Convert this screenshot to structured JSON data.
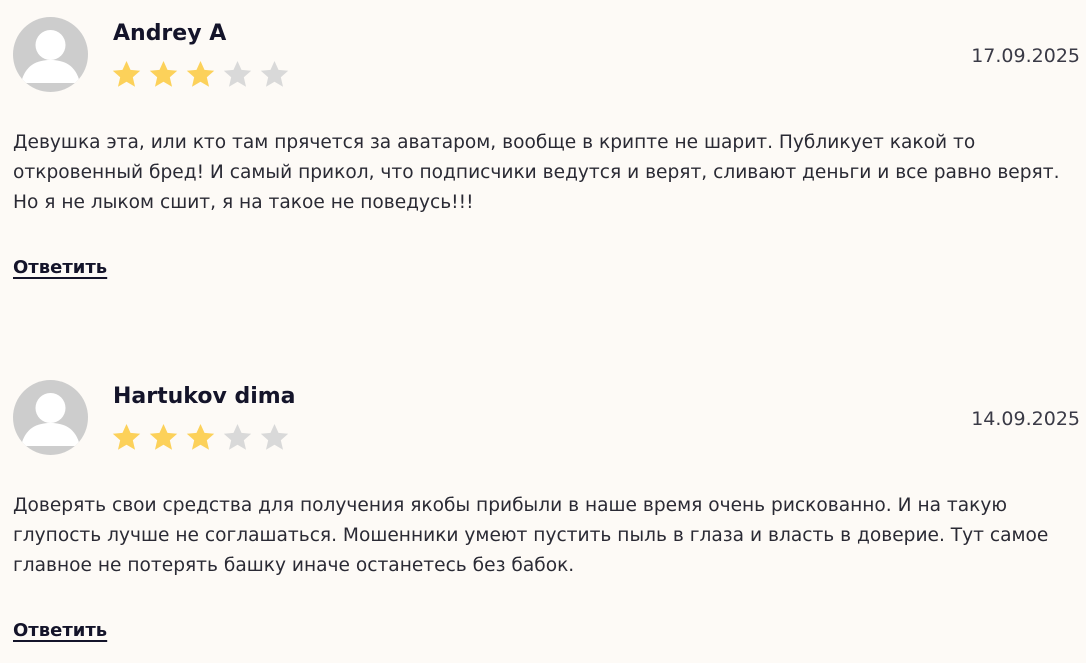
{
  "reviews": [
    {
      "author": "Andrey A",
      "date": "17.09.2025",
      "rating": 3,
      "max_rating": 5,
      "text": "Девушка эта, или кто там прячется за аватаром, вообще в крипте не шарит. Публикует какой то откровенный бред! И самый прикол, что подписчики ведутся и верят, сливают деньги и все равно верят. Но я не лыком сшит, я на такое не поведусь!!!",
      "reply_label": "Ответить"
    },
    {
      "author": "Hartukov dima",
      "date": "14.09.2025",
      "rating": 3,
      "max_rating": 5,
      "text": "Доверять свои средства для получения якобы прибыли в наше время очень рискованно. И на такую глупость лучше не соглашаться. Мошенники умеют пустить пыль в глаза и власть в доверие. Тут самое главное не потерять башку иначе останетесь без бабок.",
      "reply_label": "Ответить"
    }
  ],
  "colors": {
    "background": "#fdfaf6",
    "star_filled": "#fcd15a",
    "star_empty": "#d9d9d9",
    "avatar_bg": "#cdcdcd",
    "avatar_fg": "#ffffff"
  },
  "icons": {
    "avatar": "user-avatar-icon",
    "star": "star-icon"
  }
}
